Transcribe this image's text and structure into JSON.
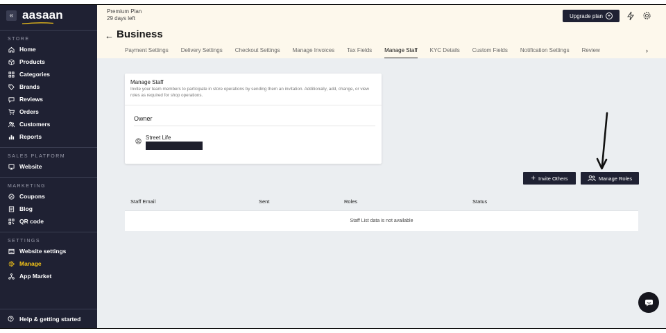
{
  "sidebar": {
    "logo": "aasaan",
    "collapse_glyph": "«",
    "sections": [
      {
        "title": "STORE",
        "items": [
          {
            "label": "Home",
            "icon": "home-icon"
          },
          {
            "label": "Products",
            "icon": "box-icon"
          },
          {
            "label": "Categories",
            "icon": "grid-icon"
          },
          {
            "label": "Brands",
            "icon": "tag-icon"
          },
          {
            "label": "Reviews",
            "icon": "chat-icon"
          },
          {
            "label": "Orders",
            "icon": "cart-icon"
          },
          {
            "label": "Customers",
            "icon": "users-icon"
          },
          {
            "label": "Reports",
            "icon": "bar-chart-icon"
          }
        ]
      },
      {
        "title": "SALES PLATFORM",
        "items": [
          {
            "label": "Website",
            "icon": "monitor-icon"
          }
        ]
      },
      {
        "title": "MARKETING",
        "items": [
          {
            "label": "Coupons",
            "icon": "percent-icon"
          },
          {
            "label": "Blog",
            "icon": "document-icon"
          },
          {
            "label": "QR code",
            "icon": "qr-icon"
          }
        ]
      },
      {
        "title": "SETTINGS",
        "items": [
          {
            "label": "Website settings",
            "icon": "browser-icon"
          },
          {
            "label": "Manage",
            "icon": "gear-icon",
            "active": true
          },
          {
            "label": "App Market",
            "icon": "network-icon"
          }
        ]
      }
    ],
    "help_label": "Help & getting started"
  },
  "header": {
    "plan_name": "Premium Plan",
    "plan_days": "29 days left",
    "upgrade_label": "Upgrade plan",
    "title": "Business",
    "tabs": [
      {
        "label": "Payment Settings"
      },
      {
        "label": "Delivery Settings"
      },
      {
        "label": "Checkout Settings"
      },
      {
        "label": "Manage Invoices"
      },
      {
        "label": "Tax Fields"
      },
      {
        "label": "Manage Staff",
        "active": true
      },
      {
        "label": "KYC Details"
      },
      {
        "label": "Custom Fields"
      },
      {
        "label": "Notification Settings"
      },
      {
        "label": "Review"
      }
    ]
  },
  "card": {
    "title": "Manage Staff",
    "description": "Invite your team members to participate in store operations by sending them an invitation. Additionally, add, change, or view roles as required for shop operations.",
    "owner_title": "Owner",
    "owner_name": "Street Life"
  },
  "actions": {
    "invite_label": "Invite Others",
    "roles_label": "Manage Roles"
  },
  "table": {
    "columns": [
      "Staff Email",
      "Sent",
      "Roles",
      "Status"
    ],
    "empty_message": "Staff List data is not available"
  },
  "colors": {
    "sidebar_bg": "#1f2133",
    "active": "#f5c518",
    "header_bg": "#fdf8ec",
    "page_bg": "#ebeef1"
  }
}
